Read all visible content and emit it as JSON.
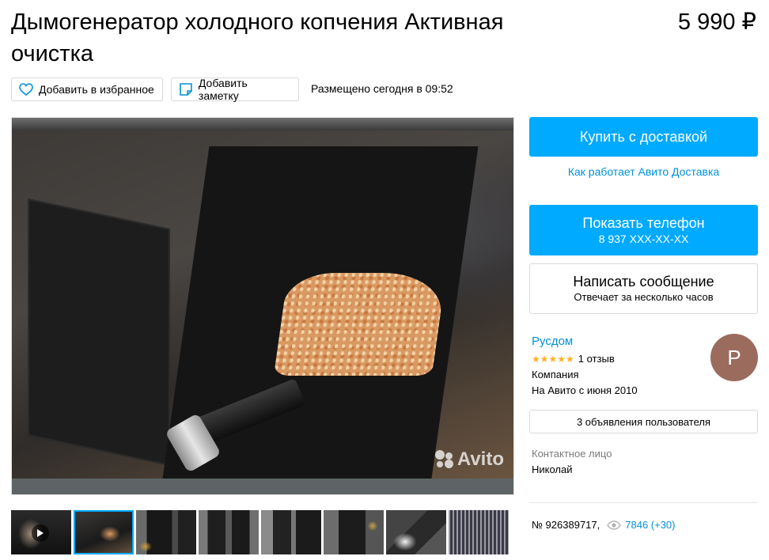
{
  "listing": {
    "title": "Дымогенератор холодного копчения Активная очистка",
    "price": "5 990 ₽",
    "add_favorite": "Добавить в избранное",
    "add_note": "Добавить заметку",
    "posted": "Размещено сегодня в 09:52",
    "number": "№ 926389717,",
    "views": "7846 (+30)"
  },
  "photo": {
    "watermark": "Avito",
    "thumbnail_count": 8,
    "active_thumbnail": 2
  },
  "actions": {
    "buy": "Купить с доставкой",
    "delivery_link": "Как работает Авито Доставка",
    "show_phone": "Показать телефон",
    "phone_masked": "8 937 XXX-XX-XX",
    "write_message": "Написать сообщение",
    "reply_time": "Отвечает за несколько часов"
  },
  "seller": {
    "name": "Русдом",
    "stars": "★★★★★",
    "reviews": "1 отзыв",
    "type": "Компания",
    "since": "На Авито с июня 2010",
    "avatar_letter": "Р",
    "user_ads": "3 объявления пользователя",
    "contact_label": "Контактное лицо",
    "contact_name": "Николай"
  },
  "colors": {
    "accent": "#00aaff",
    "link": "#0091d9",
    "avatar": "#9b6b5d",
    "stars": "#ffb021"
  }
}
